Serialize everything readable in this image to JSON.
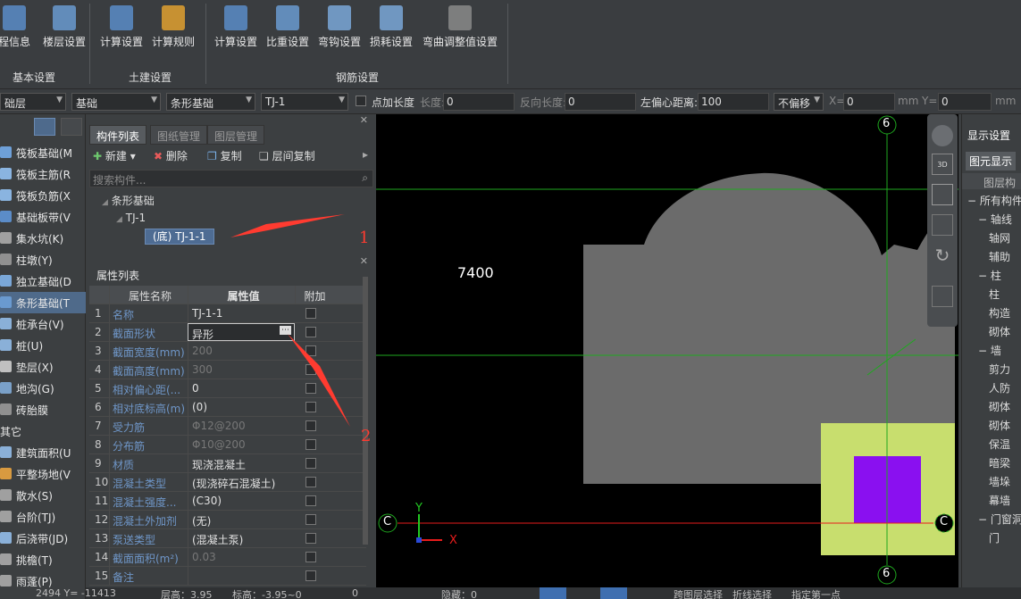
{
  "ribbon": {
    "buttons": [
      {
        "label": "程信息",
        "icon": "project-info-icon"
      },
      {
        "label": "楼层设置",
        "icon": "floor-settings-icon"
      },
      {
        "label": "计算设置",
        "icon": "calc-settings-icon"
      },
      {
        "label": "计算规则",
        "icon": "calc-rules-icon"
      },
      {
        "label": "计算设置",
        "icon": "rebar-calc-settings-icon"
      },
      {
        "label": "比重设置",
        "icon": "density-settings-icon"
      },
      {
        "label": "弯钩设置",
        "icon": "hook-settings-icon"
      },
      {
        "label": "损耗设置",
        "icon": "loss-settings-icon"
      },
      {
        "label": "弯曲调整值设置",
        "icon": "bend-adjust-icon"
      }
    ],
    "groups": [
      "基本设置",
      "土建设置",
      "钢筋设置"
    ]
  },
  "toolbar2": {
    "floor": "础层",
    "category": "基础",
    "type": "条形基础",
    "element": "TJ-1",
    "point_length_label": "点加长度",
    "length_label": "长度:",
    "length_value": "0",
    "reverse_length_label": "反向长度:",
    "reverse_length_value": "0",
    "left_offset_label": "左偏心距离:",
    "left_offset_value": "100",
    "offset_mode": "不偏移",
    "x_label": "X=",
    "x_value": "0",
    "unit_mm": "mm",
    "y_label": "Y=",
    "y_value": "0"
  },
  "leftnav": {
    "items": [
      {
        "label": "筏板基础(M",
        "color": "#6ea0d8"
      },
      {
        "label": "筏板主筋(R",
        "color": "#8ab4e0"
      },
      {
        "label": "筏板负筋(X",
        "color": "#8ab4e0"
      },
      {
        "label": "基础板带(V",
        "color": "#5b8cc8"
      },
      {
        "label": "集水坑(K)",
        "color": "#a0a0a0"
      },
      {
        "label": "柱墩(Y)",
        "color": "#909090"
      },
      {
        "label": "独立基础(D",
        "color": "#7aa7d8"
      },
      {
        "label": "条形基础(T",
        "color": "#6a9ad0"
      },
      {
        "label": "桩承台(V)",
        "color": "#8ab0d8"
      },
      {
        "label": "桩(U)",
        "color": "#8ab0d8"
      },
      {
        "label": "垫层(X)",
        "color": "#c0c0c0"
      },
      {
        "label": "地沟(G)",
        "color": "#7aa0c8"
      },
      {
        "label": "砖胎膜",
        "color": "#909090"
      },
      {
        "label": "其它",
        "color": ""
      },
      {
        "label": "建筑面积(U",
        "color": "#8ab0d8"
      },
      {
        "label": "平整场地(V",
        "color": "#d89a40"
      },
      {
        "label": "散水(S)",
        "color": "#a0a0a0"
      },
      {
        "label": "台阶(TJ)",
        "color": "#a0a0a0"
      },
      {
        "label": "后浇带(JD)",
        "color": "#8ab0d8"
      },
      {
        "label": "挑檐(T)",
        "color": "#a0a0a0"
      },
      {
        "label": "雨蓬(P)",
        "color": "#a0a0a0"
      }
    ]
  },
  "component_panel": {
    "tabs": [
      "构件列表",
      "图纸管理",
      "图层管理"
    ],
    "new_label": "新建",
    "delete_label": "删除",
    "copy_label": "复制",
    "floor_copy_label": "层间复制",
    "search_placeholder": "搜索构件...",
    "tree_root": "条形基础",
    "tree_child": "TJ-1",
    "tree_leaf": "(底) TJ-1-1"
  },
  "property_panel": {
    "title": "属性列表",
    "col_name": "属性名称",
    "col_value": "属性值",
    "col_extra": "附加",
    "rows": [
      {
        "n": "1",
        "name": "名称",
        "value": "TJ-1-1"
      },
      {
        "n": "2",
        "name": "截面形状",
        "value": "异形"
      },
      {
        "n": "3",
        "name": "截面宽度(mm)",
        "value": "200"
      },
      {
        "n": "4",
        "name": "截面高度(mm)",
        "value": "300"
      },
      {
        "n": "5",
        "name": "相对偏心距(...",
        "value": "0"
      },
      {
        "n": "6",
        "name": "相对底标高(m)",
        "value": "(0)"
      },
      {
        "n": "7",
        "name": "受力筋",
        "value": "Φ12@200"
      },
      {
        "n": "8",
        "name": "分布筋",
        "value": "Φ10@200"
      },
      {
        "n": "9",
        "name": "材质",
        "value": "现浇混凝土"
      },
      {
        "n": "10",
        "name": "混凝土类型",
        "value": "(现浇碎石混凝土)"
      },
      {
        "n": "11",
        "name": "混凝土强度...",
        "value": "(C30)"
      },
      {
        "n": "12",
        "name": "混凝土外加剂",
        "value": "(无)"
      },
      {
        "n": "13",
        "name": "泵送类型",
        "value": "(混凝土泵)"
      },
      {
        "n": "14",
        "name": "截面面积(m²)",
        "value": "0.03"
      },
      {
        "n": "15",
        "name": "备注",
        "value": ""
      }
    ]
  },
  "annotations": {
    "marker1": "1",
    "marker2": "2"
  },
  "canvas": {
    "dimension_label": "7400",
    "axis_top": "6",
    "axis_bottom": "6",
    "axis_left": "C",
    "axis_right": "C",
    "ucs_x": "X",
    "ucs_y": "Y",
    "view_3d": "3D"
  },
  "right_panel": {
    "title": "显示设置",
    "tab": "图元显示",
    "col_header": "图层构",
    "items": [
      {
        "label": "所有构件",
        "indent": 0,
        "toggle": "−"
      },
      {
        "label": "轴线",
        "indent": 1,
        "toggle": "−"
      },
      {
        "label": "轴网",
        "indent": 2,
        "toggle": ""
      },
      {
        "label": "辅助",
        "indent": 2,
        "toggle": ""
      },
      {
        "label": "柱",
        "indent": 1,
        "toggle": "−"
      },
      {
        "label": "柱",
        "indent": 2,
        "toggle": ""
      },
      {
        "label": "构造",
        "indent": 2,
        "toggle": ""
      },
      {
        "label": "砌体",
        "indent": 2,
        "toggle": ""
      },
      {
        "label": "墙",
        "indent": 1,
        "toggle": "−"
      },
      {
        "label": "剪力",
        "indent": 2,
        "toggle": ""
      },
      {
        "label": "人防",
        "indent": 2,
        "toggle": ""
      },
      {
        "label": "砌体",
        "indent": 2,
        "toggle": ""
      },
      {
        "label": "砌体",
        "indent": 2,
        "toggle": ""
      },
      {
        "label": "保温",
        "indent": 2,
        "toggle": ""
      },
      {
        "label": "暗梁",
        "indent": 2,
        "toggle": ""
      },
      {
        "label": "墙垛",
        "indent": 2,
        "toggle": ""
      },
      {
        "label": "幕墙",
        "indent": 2,
        "toggle": ""
      },
      {
        "label": "门窗洞",
        "indent": 1,
        "toggle": "−"
      },
      {
        "label": "门",
        "indent": 2,
        "toggle": ""
      }
    ]
  },
  "status": {
    "coords": "2494 Y= -11413",
    "floor_height": "层高：3.95",
    "elevation": "标高：-3.95~0",
    "zero": "0",
    "hidden": "隐藏：0",
    "cross_layer": "跨图层选择",
    "polyline_select": "折线选择",
    "specified": "指定第一点"
  },
  "colors": {
    "canvas_bg": "#000000",
    "shape_gray": "#6b6b6b",
    "pad_green": "#c8de6e",
    "column_purple": "#8a10f0",
    "axis_green": "#1fa81f",
    "axis_red": "#e81c1c",
    "marker_red": "#ff3b30"
  }
}
